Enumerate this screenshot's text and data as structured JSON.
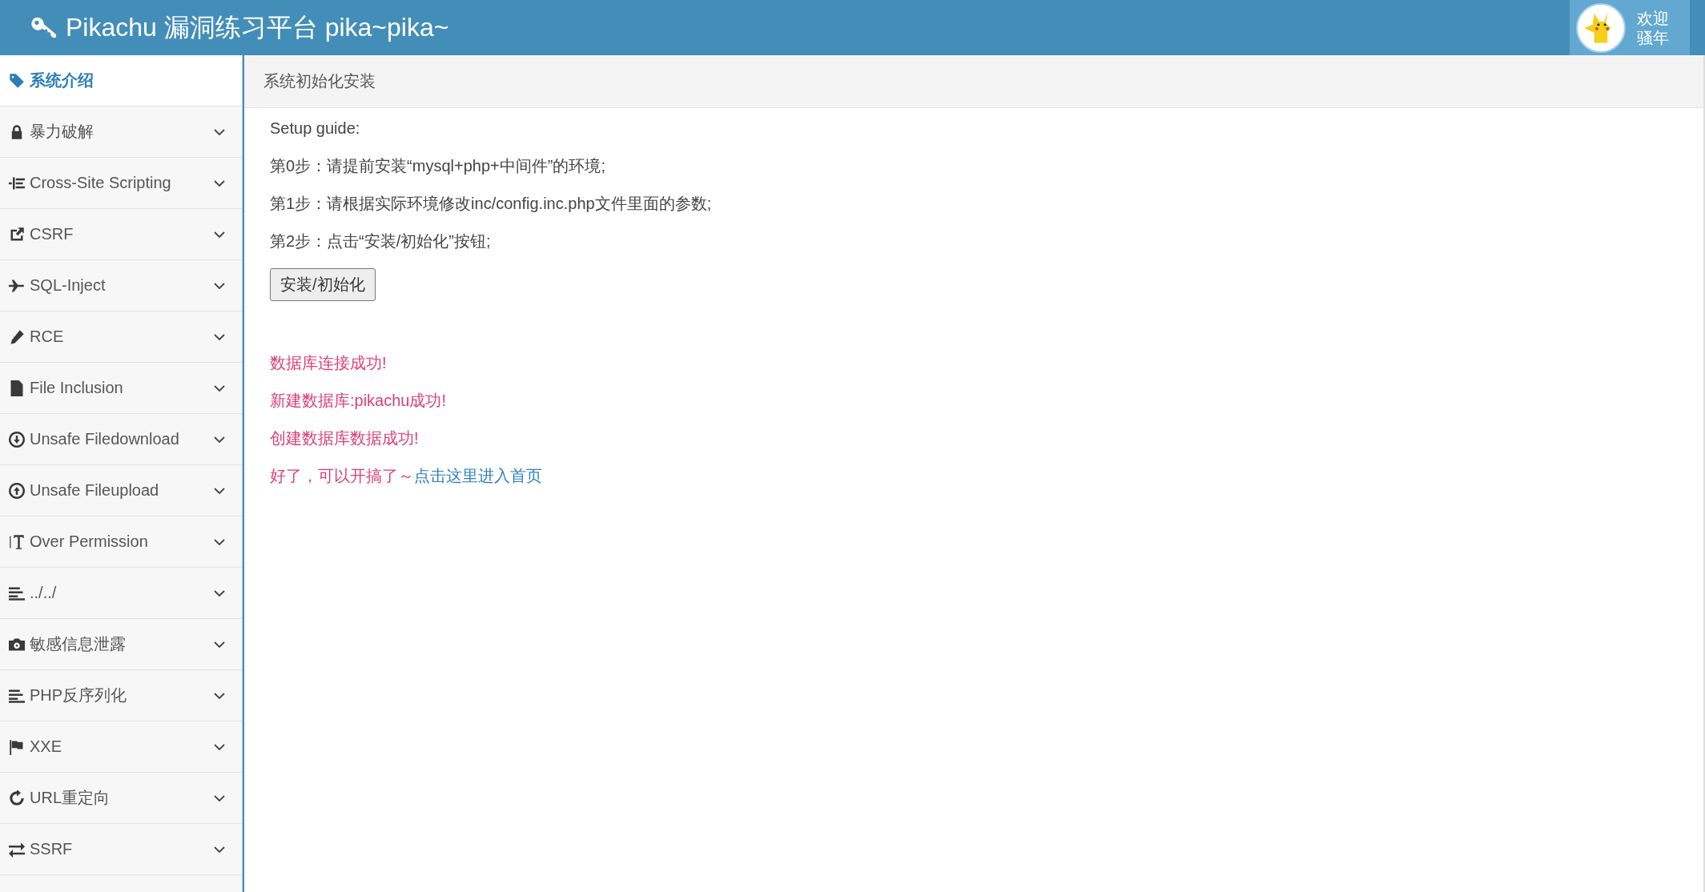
{
  "header": {
    "title": "Pikachu 漏洞练习平台 pika~pika~",
    "welcome": [
      "欢迎",
      "骚年"
    ]
  },
  "sidebar": {
    "items": [
      {
        "label": "系统介绍",
        "selected": true
      },
      {
        "label": "暴力破解",
        "selected": false
      },
      {
        "label": "Cross-Site Scripting",
        "selected": false
      },
      {
        "label": "CSRF",
        "selected": false
      },
      {
        "label": "SQL-Inject",
        "selected": false
      },
      {
        "label": "RCE",
        "selected": false
      },
      {
        "label": "File Inclusion",
        "selected": false
      },
      {
        "label": "Unsafe Filedownload",
        "selected": false
      },
      {
        "label": "Unsafe Fileupload",
        "selected": false
      },
      {
        "label": "Over Permission",
        "selected": false
      },
      {
        "label": "../../",
        "selected": false
      },
      {
        "label": "敏感信息泄露",
        "selected": false
      },
      {
        "label": "PHP反序列化",
        "selected": false
      },
      {
        "label": "XXE",
        "selected": false
      },
      {
        "label": "URL重定向",
        "selected": false
      },
      {
        "label": "SSRF",
        "selected": false
      }
    ]
  },
  "breadcrumb": "系统初始化安装",
  "guide": {
    "title": "Setup guide:",
    "steps": [
      "第0步：请提前安装“mysql+php+中间件”的环境;",
      "第1步：请根据实际环境修改inc/config.inc.php文件里面的参数;",
      "第2步：点击“安装/初始化”按钮;"
    ],
    "button": "安装/初始化"
  },
  "messages": [
    {
      "text": "数据库连接成功!"
    },
    {
      "text": "新建数据库:pikachu成功!"
    },
    {
      "text": "创建数据库数据成功!"
    },
    {
      "text": "好了，可以开搞了～",
      "link": "点击这里进入首页"
    }
  ]
}
